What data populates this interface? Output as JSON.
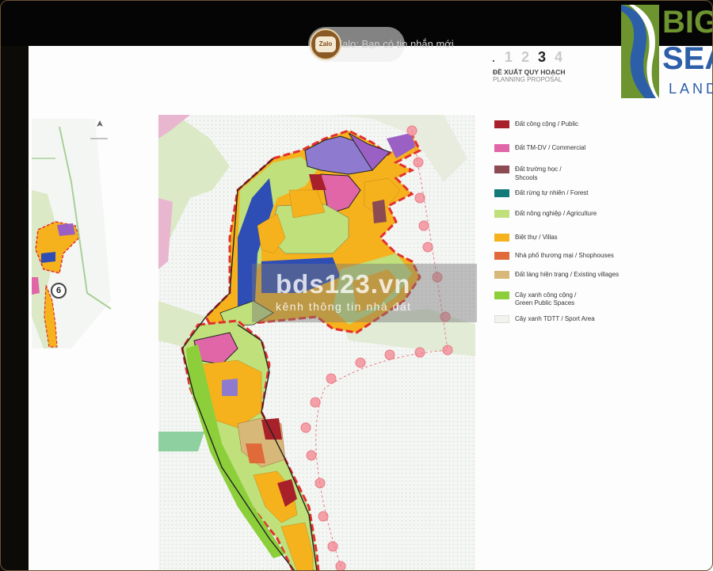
{
  "notification": {
    "text": "Zalo: Bạn có tin nhắn mới",
    "icon": "zalo-icon",
    "icon_label": "Zalo"
  },
  "brand": {
    "line1": "BIG",
    "line2": "SEA",
    "line3": "LAND",
    "colors": {
      "green": "#6e9430",
      "blue": "#2c5fa8"
    }
  },
  "steps": {
    "prefix": ".",
    "items": [
      "1",
      "2",
      "3",
      "4"
    ],
    "active": "3"
  },
  "header": {
    "title_vi": "ĐỀ XUẤT QUY HOẠCH",
    "title_en": "PLANNING PROPOSAL"
  },
  "legend": [
    {
      "label": "Đất công cộng / Public",
      "color": "#a8202a"
    },
    {
      "label": "Đất TM-DV / Commercial",
      "color": "#e066a8"
    },
    {
      "label": "Đất trường học /",
      "label2": "Shcools",
      "color": "#8c4a52"
    },
    {
      "label": "Đất rừng tự nhiên / Forest",
      "color": "#127a78"
    },
    {
      "label": "Đất nông nghiệp / Agriculture",
      "color": "#bfe07a"
    },
    {
      "label": "Biệt thự / Villas",
      "color": "#f6b21c"
    },
    {
      "label": "Nhà phố thương mại / Shophouses",
      "color": "#e06a3a"
    },
    {
      "label": "Đất làng hiện trạng / Existing villages",
      "color": "#d8b878"
    },
    {
      "label": "Cây xanh công cộng /",
      "label2": "Green Public Spaces",
      "color": "#8ccf3a"
    },
    {
      "label": "Cây xanh TDTT / Sport Area",
      "color": "#f2f2ee"
    }
  ],
  "map": {
    "marker_number": "6"
  },
  "watermark": {
    "title": "bds123.vn",
    "subtitle": "kênh thông tin nhà đất"
  }
}
